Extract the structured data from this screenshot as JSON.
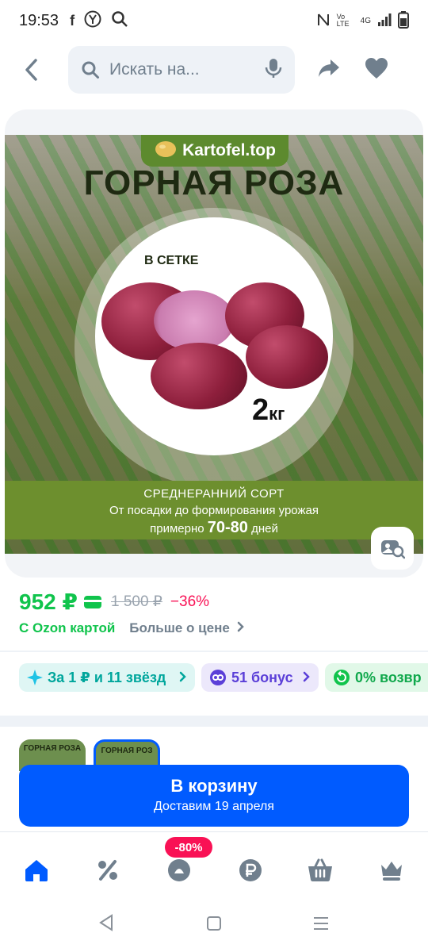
{
  "status_bar": {
    "time": "19:53",
    "network_label": "4G",
    "volte_label": "Vo LTE"
  },
  "search": {
    "placeholder": "Искать на..."
  },
  "colors": {
    "accent": "#005bff",
    "price_green": "#10c44c",
    "discount_pink": "#f91155",
    "bonus_purple": "#5b3fd8",
    "stars_teal": "#00a69c"
  },
  "product_image": {
    "brand": "Kartofel.top",
    "variety": "ГОРНАЯ РОЗА",
    "packaging": "В СЕТКЕ",
    "weight_value": "2",
    "weight_unit": "кг",
    "maturity": "СРЕДНЕРАННИЙ СОРТ",
    "period_line": "От посадки до формирования урожая",
    "period_prefix": "примерно",
    "period_days": "70-80",
    "period_suffix": "дней"
  },
  "price": {
    "current": "952 ₽",
    "old": "1 500 ₽",
    "discount": "−36%",
    "with_card": "С Ozon картой",
    "more_info": "Больше о цене"
  },
  "chips": [
    {
      "label": "За 1 ₽ и 11 звёзд",
      "icon": "sparkle-icon"
    },
    {
      "label": "51 бонус",
      "icon": "bonus-icon"
    },
    {
      "label": "0% возвр",
      "icon": "return-icon"
    }
  ],
  "thumbnails": [
    {
      "label": "ГОРНАЯ РОЗА"
    },
    {
      "label": "ГОРНАЯ РОЗ"
    }
  ],
  "cart": {
    "title": "В корзину",
    "subtitle": "Доставим 19 апреля"
  },
  "bottom_nav": {
    "items": [
      "home-icon",
      "discount-icon",
      "fresh-icon",
      "ruble-icon",
      "cart-icon",
      "crown-icon"
    ],
    "badge": "-80%"
  }
}
